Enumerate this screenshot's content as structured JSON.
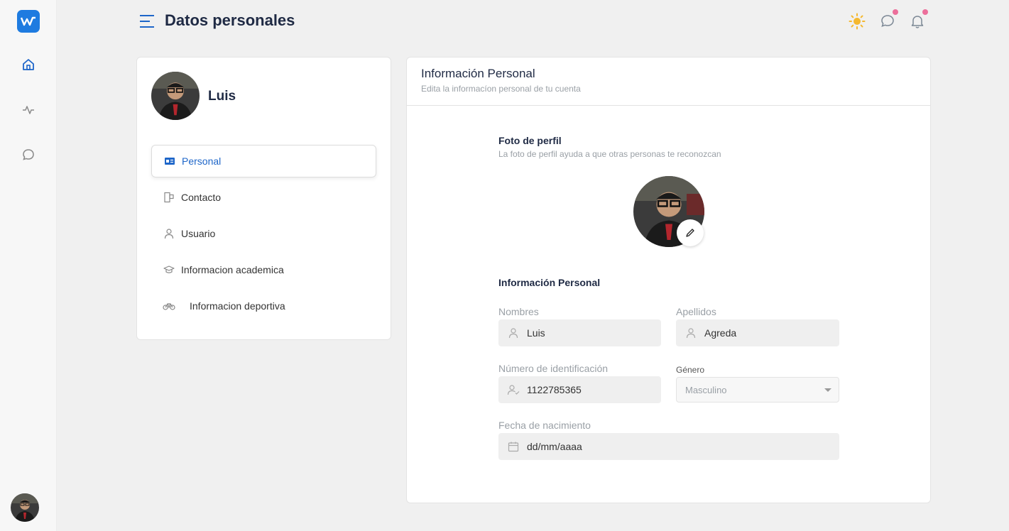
{
  "header": {
    "title": "Datos personales"
  },
  "profile": {
    "name": "Luis"
  },
  "menu": [
    {
      "label": "Personal",
      "icon": "id-card-icon",
      "active": true
    },
    {
      "label": "Contacto",
      "icon": "contact-icon"
    },
    {
      "label": "Usuario",
      "icon": "user-icon"
    },
    {
      "label": "Informacion academica",
      "icon": "graduation-cap-icon"
    },
    {
      "label": "Informacion deportiva",
      "icon": "bicycle-icon"
    }
  ],
  "card": {
    "title": "Información Personal",
    "subtitle": "Edita la informacíon personal de tu cuenta"
  },
  "photo_section": {
    "title": "Foto de perfil",
    "subtitle": "La foto de perfil ayuda a que otras personas te reconozcan"
  },
  "info_section": {
    "title": "Información Personal"
  },
  "form": {
    "nombres": {
      "label": "Nombres",
      "value": "Luis"
    },
    "apellidos": {
      "label": "Apellidos",
      "value": "Agreda"
    },
    "identificacion": {
      "label": "Número de identificación",
      "value": "1122785365"
    },
    "genero": {
      "label": "Género",
      "value": "Masculino"
    },
    "fecha": {
      "label": "Fecha de nacimiento",
      "value": "dd/mm/aaaa"
    }
  },
  "colors": {
    "accent": "#1e66c9",
    "sun": "#f5b82e",
    "badge": "#ec6f9b"
  }
}
